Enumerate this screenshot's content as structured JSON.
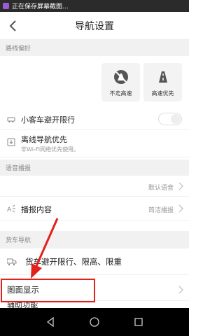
{
  "status_bar": {
    "text": "正在保存屏幕截图..."
  },
  "header": {
    "title": "导航设置"
  },
  "sections": {
    "route_pref": "路线偏好",
    "voice": "语音播报",
    "truck": "货车导航"
  },
  "route_options": [
    {
      "label": "不走高速",
      "icon": "no-highway-icon"
    },
    {
      "label": "高速优先",
      "icon": "highway-icon"
    }
  ],
  "rows": {
    "car_restriction": {
      "label": "小客车避开限行"
    },
    "offline_nav": {
      "label": "离线导航优先",
      "sub": "非Wi-Fi网络优先使用。"
    },
    "default_voice": {
      "value": "默认语音"
    },
    "broadcast_content": {
      "label": "播报内容",
      "value": "简洁播报"
    },
    "truck_restriction": {
      "label": "货车避开限行、限高、限重"
    },
    "map_display": {
      "label": "图面显示"
    },
    "aux": {
      "label": "辅助功能"
    }
  },
  "colors": {
    "highlight": "#e2211b",
    "arrow": "#e2211b"
  }
}
